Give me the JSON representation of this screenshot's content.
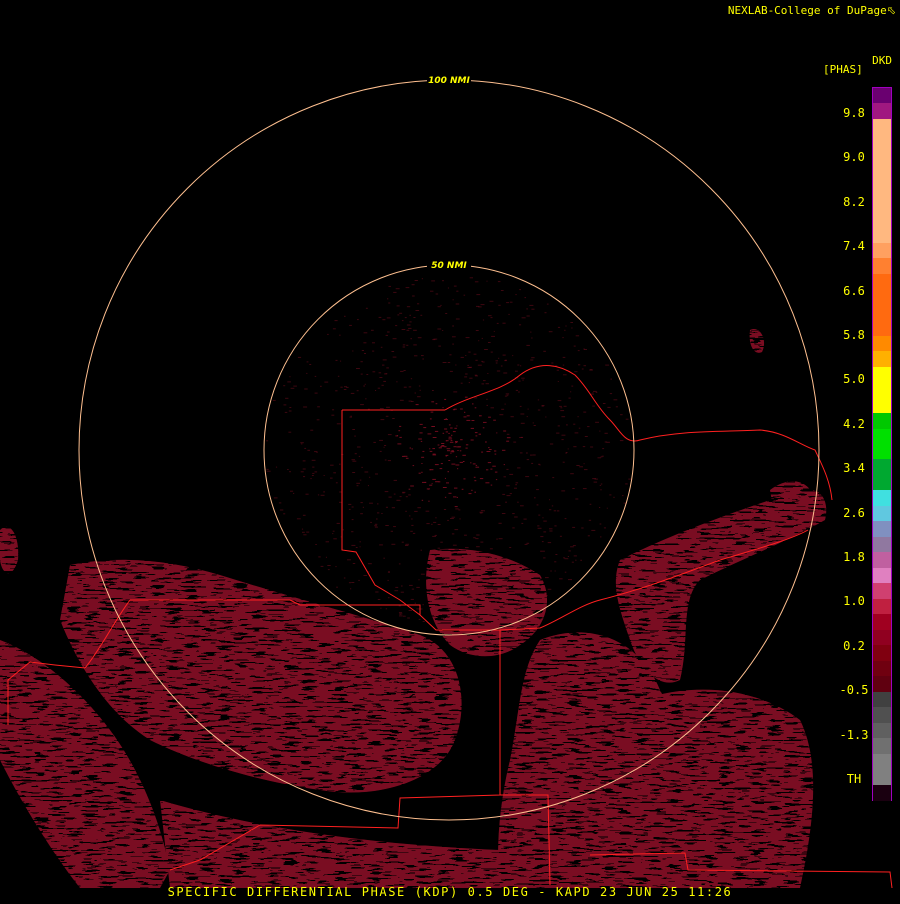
{
  "credit": "NEXLAB-College of DuPage",
  "credit_icon": "cursor-arrow-icon",
  "product_code": "DKD",
  "product_unit": "[PHAS]",
  "range_rings": [
    {
      "label": "100 NMI",
      "color": "#ffc090"
    },
    {
      "label": "50 NMI",
      "color": "#ffc090"
    }
  ],
  "range_ring_label_color": "#ffff00",
  "boundary_color": "#ff2020",
  "precip_color": "#7a0d20",
  "colorbar": {
    "ticks": [
      "9.8",
      "9.0",
      "8.2",
      "7.4",
      "6.6",
      "5.8",
      "5.0",
      "4.2",
      "3.4",
      "2.6",
      "1.8",
      "1.0",
      "0.2",
      "-0.5",
      "-1.3",
      "TH"
    ],
    "bands": [
      "#6a0070",
      "#a01880",
      "#ffb880",
      "#ffb880",
      "#ffb880",
      "#ffb880",
      "#ffb880",
      "#ffb880",
      "#ffb880",
      "#ffb880",
      "#ffa060",
      "#ff8030",
      "#ff6a10",
      "#ff6a10",
      "#ff6a10",
      "#ff6a10",
      "#ff8a00",
      "#ffb000",
      "#ffff00",
      "#ffff00",
      "#ffff00",
      "#00c800",
      "#00e000",
      "#00e000",
      "#00a830",
      "#00a830",
      "#40e0e0",
      "#60c8e0",
      "#8090c0",
      "#9078a0",
      "#c060a0",
      "#e080c0",
      "#d04070",
      "#c02040",
      "#a00020",
      "#900020",
      "#800010",
      "#700010",
      "#600010",
      "#404040",
      "#505050",
      "#606060",
      "#707070",
      "#808080",
      "#808080",
      "#1a0010"
    ]
  },
  "footer": "SPECIFIC DIFFERENTIAL PHASE (KDP) 0.5 DEG - KAPD 23 JUN 25 11:26"
}
